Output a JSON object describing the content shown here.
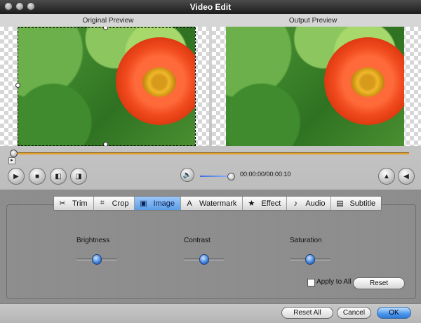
{
  "window": {
    "title": "Video Edit"
  },
  "preview": {
    "original_label": "Original Preview",
    "output_label": "Output Preview"
  },
  "playback": {
    "timecode": "00:00:00/00:00:10",
    "volume_level": 0.95,
    "progress": 0.0
  },
  "tabs": [
    {
      "label": "Trim",
      "icon": "scissors-icon",
      "glyph": "✂"
    },
    {
      "label": "Crop",
      "icon": "crop-icon",
      "glyph": "⌗"
    },
    {
      "label": "Image",
      "icon": "image-icon",
      "glyph": "▣",
      "selected": true
    },
    {
      "label": "Watermark",
      "icon": "watermark-icon",
      "glyph": "A"
    },
    {
      "label": "Effect",
      "icon": "star-icon",
      "glyph": "★"
    },
    {
      "label": "Audio",
      "icon": "music-note-icon",
      "glyph": "♪"
    },
    {
      "label": "Subtitle",
      "icon": "subtitle-icon",
      "glyph": "▤"
    }
  ],
  "image_settings": {
    "brightness_label": "Brightness",
    "contrast_label": "Contrast",
    "saturation_label": "Saturation",
    "brightness": 0.5,
    "contrast": 0.5,
    "saturation": 0.5,
    "apply_to_all_label": "Apply to All",
    "apply_to_all_checked": false,
    "reset_label": "Reset"
  },
  "footer": {
    "reset_all_label": "Reset All",
    "cancel_label": "Cancel",
    "ok_label": "OK"
  },
  "colors": {
    "accent": "#5b9de6",
    "timeline": "#e3a12a"
  }
}
